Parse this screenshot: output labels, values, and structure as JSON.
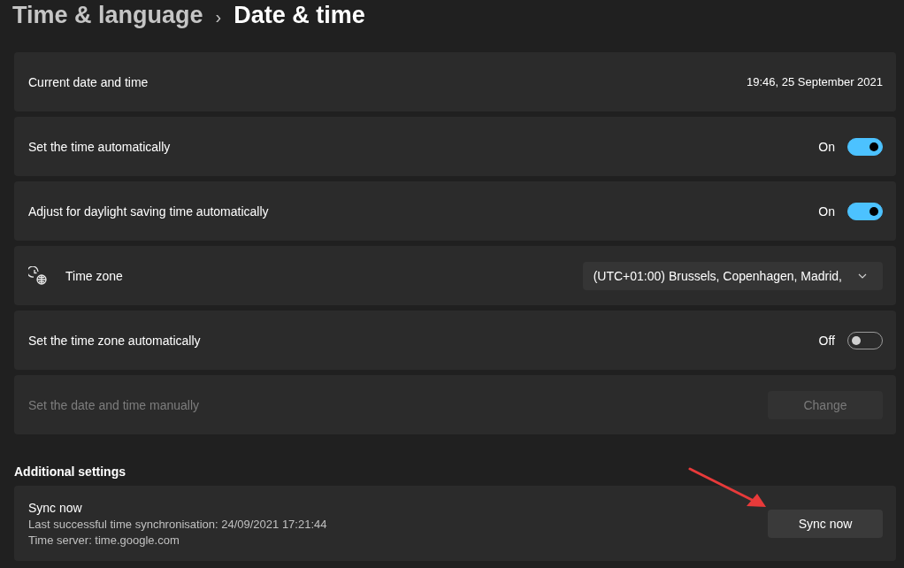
{
  "breadcrumb": {
    "parent": "Time & language",
    "separator": "›",
    "current": "Date & time"
  },
  "settings": [
    {
      "kind": "value",
      "label": "Current date and time",
      "value": "19:46, 25 September 2021"
    },
    {
      "kind": "toggle",
      "label": "Set the time automatically",
      "state_label": "On",
      "on": true
    },
    {
      "kind": "toggle",
      "label": "Adjust for daylight saving time automatically",
      "state_label": "On",
      "on": true
    },
    {
      "kind": "dropdown",
      "label": "Time zone",
      "value": "(UTC+01:00) Brussels, Copenhagen, Madrid,"
    },
    {
      "kind": "toggle",
      "label": "Set the time zone automatically",
      "state_label": "Off",
      "on": false
    },
    {
      "kind": "button",
      "label": "Set the date and time manually",
      "button": "Change",
      "disabled": true
    }
  ],
  "additional_settings": {
    "heading": "Additional settings",
    "sync": {
      "title": "Sync now",
      "lines": [
        "Last successful time synchronisation: 24/09/2021 17:21:44",
        "Time server: time.google.com"
      ],
      "button": "Sync now"
    }
  }
}
